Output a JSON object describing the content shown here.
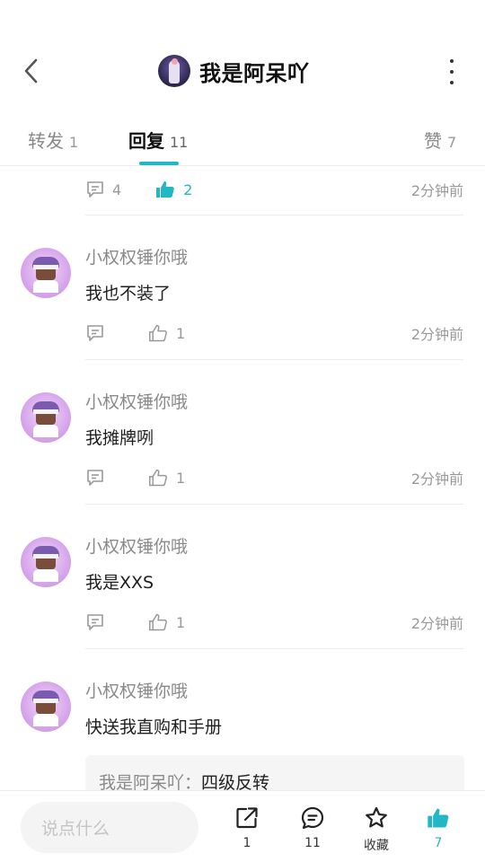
{
  "header": {
    "title": "我是阿呆吖"
  },
  "tabs": [
    {
      "label": "转发",
      "count": "1"
    },
    {
      "label": "回复",
      "count": "11"
    },
    {
      "label": "赞",
      "count": "7"
    }
  ],
  "top_row": {
    "comment_count": "4",
    "like_count": "2",
    "time": "2分钟前",
    "liked": true
  },
  "replies": [
    {
      "username": "小权权锤你哦",
      "text": "我也不装了",
      "like_count": "1",
      "time": "2分钟前"
    },
    {
      "username": "小权权锤你哦",
      "text": "我摊牌咧",
      "like_count": "1",
      "time": "2分钟前"
    },
    {
      "username": "小权权锤你哦",
      "text": "我是XXS",
      "like_count": "1",
      "time": "2分钟前"
    },
    {
      "username": "小权权锤你哦",
      "text": "快送我直购和手册",
      "quote_author": "我是阿呆吖：",
      "quote_text": "四级反转"
    }
  ],
  "bottom_bar": {
    "input_placeholder": "说点什么",
    "share_label": "1",
    "comment_label": "11",
    "favorite_label": "收藏",
    "like_label": "7"
  },
  "colors": {
    "accent": "#21b7c4",
    "muted_text": "#999999",
    "avatar_bg": "#d7a6ec"
  }
}
